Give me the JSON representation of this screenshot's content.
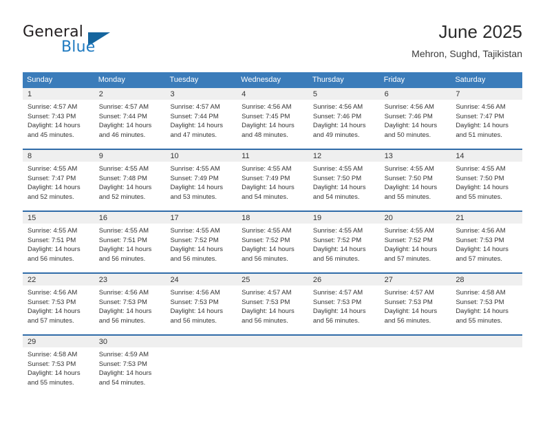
{
  "brand": {
    "name_top": "General",
    "name_bottom": "Blue",
    "triangle_icon": "brand-triangle-icon",
    "color_dark": "#231f20",
    "color_blue": "#1f7ac0",
    "color_triangle": "#15659e"
  },
  "header": {
    "title": "June 2025",
    "subtitle": "Mehron, Sughd, Tajikistan"
  },
  "theme": {
    "header_bg": "#3b7cba",
    "row_divider": "#2f6ba8",
    "day_band_bg": "#efefef",
    "text": "#333333"
  },
  "weekdays": [
    "Sunday",
    "Monday",
    "Tuesday",
    "Wednesday",
    "Thursday",
    "Friday",
    "Saturday"
  ],
  "weeks": [
    [
      {
        "day": "1",
        "sunrise": "Sunrise: 4:57 AM",
        "sunset": "Sunset: 7:43 PM",
        "daylight_1": "Daylight: 14 hours",
        "daylight_2": "and 45 minutes."
      },
      {
        "day": "2",
        "sunrise": "Sunrise: 4:57 AM",
        "sunset": "Sunset: 7:44 PM",
        "daylight_1": "Daylight: 14 hours",
        "daylight_2": "and 46 minutes."
      },
      {
        "day": "3",
        "sunrise": "Sunrise: 4:57 AM",
        "sunset": "Sunset: 7:44 PM",
        "daylight_1": "Daylight: 14 hours",
        "daylight_2": "and 47 minutes."
      },
      {
        "day": "4",
        "sunrise": "Sunrise: 4:56 AM",
        "sunset": "Sunset: 7:45 PM",
        "daylight_1": "Daylight: 14 hours",
        "daylight_2": "and 48 minutes."
      },
      {
        "day": "5",
        "sunrise": "Sunrise: 4:56 AM",
        "sunset": "Sunset: 7:46 PM",
        "daylight_1": "Daylight: 14 hours",
        "daylight_2": "and 49 minutes."
      },
      {
        "day": "6",
        "sunrise": "Sunrise: 4:56 AM",
        "sunset": "Sunset: 7:46 PM",
        "daylight_1": "Daylight: 14 hours",
        "daylight_2": "and 50 minutes."
      },
      {
        "day": "7",
        "sunrise": "Sunrise: 4:56 AM",
        "sunset": "Sunset: 7:47 PM",
        "daylight_1": "Daylight: 14 hours",
        "daylight_2": "and 51 minutes."
      }
    ],
    [
      {
        "day": "8",
        "sunrise": "Sunrise: 4:55 AM",
        "sunset": "Sunset: 7:47 PM",
        "daylight_1": "Daylight: 14 hours",
        "daylight_2": "and 52 minutes."
      },
      {
        "day": "9",
        "sunrise": "Sunrise: 4:55 AM",
        "sunset": "Sunset: 7:48 PM",
        "daylight_1": "Daylight: 14 hours",
        "daylight_2": "and 52 minutes."
      },
      {
        "day": "10",
        "sunrise": "Sunrise: 4:55 AM",
        "sunset": "Sunset: 7:49 PM",
        "daylight_1": "Daylight: 14 hours",
        "daylight_2": "and 53 minutes."
      },
      {
        "day": "11",
        "sunrise": "Sunrise: 4:55 AM",
        "sunset": "Sunset: 7:49 PM",
        "daylight_1": "Daylight: 14 hours",
        "daylight_2": "and 54 minutes."
      },
      {
        "day": "12",
        "sunrise": "Sunrise: 4:55 AM",
        "sunset": "Sunset: 7:50 PM",
        "daylight_1": "Daylight: 14 hours",
        "daylight_2": "and 54 minutes."
      },
      {
        "day": "13",
        "sunrise": "Sunrise: 4:55 AM",
        "sunset": "Sunset: 7:50 PM",
        "daylight_1": "Daylight: 14 hours",
        "daylight_2": "and 55 minutes."
      },
      {
        "day": "14",
        "sunrise": "Sunrise: 4:55 AM",
        "sunset": "Sunset: 7:50 PM",
        "daylight_1": "Daylight: 14 hours",
        "daylight_2": "and 55 minutes."
      }
    ],
    [
      {
        "day": "15",
        "sunrise": "Sunrise: 4:55 AM",
        "sunset": "Sunset: 7:51 PM",
        "daylight_1": "Daylight: 14 hours",
        "daylight_2": "and 56 minutes."
      },
      {
        "day": "16",
        "sunrise": "Sunrise: 4:55 AM",
        "sunset": "Sunset: 7:51 PM",
        "daylight_1": "Daylight: 14 hours",
        "daylight_2": "and 56 minutes."
      },
      {
        "day": "17",
        "sunrise": "Sunrise: 4:55 AM",
        "sunset": "Sunset: 7:52 PM",
        "daylight_1": "Daylight: 14 hours",
        "daylight_2": "and 56 minutes."
      },
      {
        "day": "18",
        "sunrise": "Sunrise: 4:55 AM",
        "sunset": "Sunset: 7:52 PM",
        "daylight_1": "Daylight: 14 hours",
        "daylight_2": "and 56 minutes."
      },
      {
        "day": "19",
        "sunrise": "Sunrise: 4:55 AM",
        "sunset": "Sunset: 7:52 PM",
        "daylight_1": "Daylight: 14 hours",
        "daylight_2": "and 56 minutes."
      },
      {
        "day": "20",
        "sunrise": "Sunrise: 4:55 AM",
        "sunset": "Sunset: 7:52 PM",
        "daylight_1": "Daylight: 14 hours",
        "daylight_2": "and 57 minutes."
      },
      {
        "day": "21",
        "sunrise": "Sunrise: 4:56 AM",
        "sunset": "Sunset: 7:53 PM",
        "daylight_1": "Daylight: 14 hours",
        "daylight_2": "and 57 minutes."
      }
    ],
    [
      {
        "day": "22",
        "sunrise": "Sunrise: 4:56 AM",
        "sunset": "Sunset: 7:53 PM",
        "daylight_1": "Daylight: 14 hours",
        "daylight_2": "and 57 minutes."
      },
      {
        "day": "23",
        "sunrise": "Sunrise: 4:56 AM",
        "sunset": "Sunset: 7:53 PM",
        "daylight_1": "Daylight: 14 hours",
        "daylight_2": "and 56 minutes."
      },
      {
        "day": "24",
        "sunrise": "Sunrise: 4:56 AM",
        "sunset": "Sunset: 7:53 PM",
        "daylight_1": "Daylight: 14 hours",
        "daylight_2": "and 56 minutes."
      },
      {
        "day": "25",
        "sunrise": "Sunrise: 4:57 AM",
        "sunset": "Sunset: 7:53 PM",
        "daylight_1": "Daylight: 14 hours",
        "daylight_2": "and 56 minutes."
      },
      {
        "day": "26",
        "sunrise": "Sunrise: 4:57 AM",
        "sunset": "Sunset: 7:53 PM",
        "daylight_1": "Daylight: 14 hours",
        "daylight_2": "and 56 minutes."
      },
      {
        "day": "27",
        "sunrise": "Sunrise: 4:57 AM",
        "sunset": "Sunset: 7:53 PM",
        "daylight_1": "Daylight: 14 hours",
        "daylight_2": "and 56 minutes."
      },
      {
        "day": "28",
        "sunrise": "Sunrise: 4:58 AM",
        "sunset": "Sunset: 7:53 PM",
        "daylight_1": "Daylight: 14 hours",
        "daylight_2": "and 55 minutes."
      }
    ],
    [
      {
        "day": "29",
        "sunrise": "Sunrise: 4:58 AM",
        "sunset": "Sunset: 7:53 PM",
        "daylight_1": "Daylight: 14 hours",
        "daylight_2": "and 55 minutes."
      },
      {
        "day": "30",
        "sunrise": "Sunrise: 4:59 AM",
        "sunset": "Sunset: 7:53 PM",
        "daylight_1": "Daylight: 14 hours",
        "daylight_2": "and 54 minutes."
      },
      {
        "day": "",
        "sunrise": "",
        "sunset": "",
        "daylight_1": "",
        "daylight_2": ""
      },
      {
        "day": "",
        "sunrise": "",
        "sunset": "",
        "daylight_1": "",
        "daylight_2": ""
      },
      {
        "day": "",
        "sunrise": "",
        "sunset": "",
        "daylight_1": "",
        "daylight_2": ""
      },
      {
        "day": "",
        "sunrise": "",
        "sunset": "",
        "daylight_1": "",
        "daylight_2": ""
      },
      {
        "day": "",
        "sunrise": "",
        "sunset": "",
        "daylight_1": "",
        "daylight_2": ""
      }
    ]
  ]
}
